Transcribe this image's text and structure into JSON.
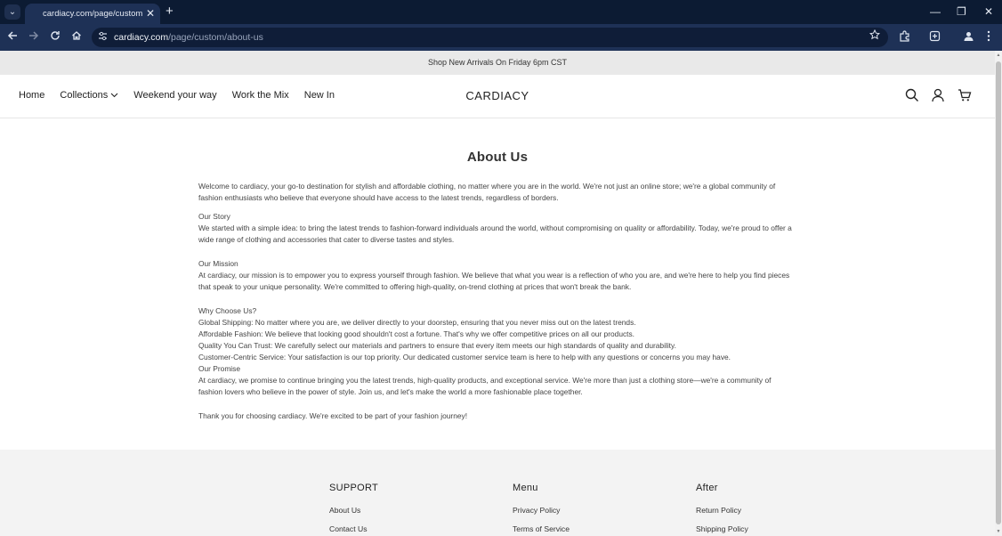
{
  "browser": {
    "tab_title": "cardiacy.com/page/custom/abo",
    "tab_dropdown_glyph": "⌄",
    "tab_close_glyph": "✕",
    "new_tab_glyph": "+",
    "url_host": "cardiacy.com",
    "url_path": "/page/custom/about-us",
    "window_controls": {
      "minimize": "—",
      "maximize": "❐",
      "close": "✕"
    },
    "icons": [
      "back-icon",
      "forward-icon",
      "reload-icon",
      "home-icon",
      "site-settings-icon",
      "star-icon",
      "extensions-icon",
      "screenshot-icon",
      "profile-icon",
      "menu-icon"
    ]
  },
  "announcement": "Shop New Arrivals On Friday 6pm CST",
  "header": {
    "nav": [
      {
        "label": "Home"
      },
      {
        "label": "Collections"
      },
      {
        "label": "Weekend your way"
      },
      {
        "label": "Work the Mix"
      },
      {
        "label": "New In"
      }
    ],
    "brand": "CARDIACY"
  },
  "content": {
    "title": "About Us",
    "intro": "Welcome to cardiacy, your go-to destination for stylish and affordable clothing, no matter where you are in the world. We're not just an online store; we're a global community of fashion enthusiasts who believe that everyone should have access to the latest trends, regardless of borders.",
    "story_heading": "Our Story",
    "story": "We started with a simple idea: to bring the latest trends to fashion-forward individuals around the world, without compromising on quality or affordability. Today, we're proud to offer a wide range of clothing and accessories that cater to diverse tastes and styles.",
    "mission_heading": "Our Mission",
    "mission": "At cardiacy, our mission is to empower you to express yourself through fashion. We believe that what you wear is a reflection of who you are, and we're here to help you find pieces that speak to your unique personality. We're committed to offering high-quality, on-trend clothing at prices that won't break the bank.",
    "why_heading": "Why Choose Us?",
    "why_items": [
      "Global Shipping: No matter where you are, we deliver directly to your doorstep, ensuring that you never miss out on the latest trends.",
      "Affordable Fashion: We believe that looking good shouldn't cost a fortune. That's why we offer competitive prices on all our products.",
      "Quality You Can Trust: We carefully select our materials and partners to ensure that every item meets our high standards of quality and durability.",
      "Customer-Centric Service: Your satisfaction is our top priority. Our dedicated customer service team is here to help with any questions or concerns you may have."
    ],
    "promise_heading": "Our Promise",
    "promise": "At cardiacy, we promise to continue bringing you the latest trends, high-quality products, and exceptional service. We're more than just a clothing store—we're a community of fashion lovers who believe in the power of style. Join us, and let's make the world a more fashionable place together.",
    "closing": "Thank you for choosing cardiacy. We're excited to be part of your fashion journey!"
  },
  "footer": {
    "columns": [
      {
        "heading": "SUPPORT",
        "links": [
          "About Us",
          "Contact Us"
        ]
      },
      {
        "heading": "Menu",
        "links": [
          "Privacy Policy",
          "Terms of Service"
        ]
      },
      {
        "heading": "After",
        "links": [
          "Return Policy",
          "Shipping Policy"
        ]
      }
    ]
  }
}
